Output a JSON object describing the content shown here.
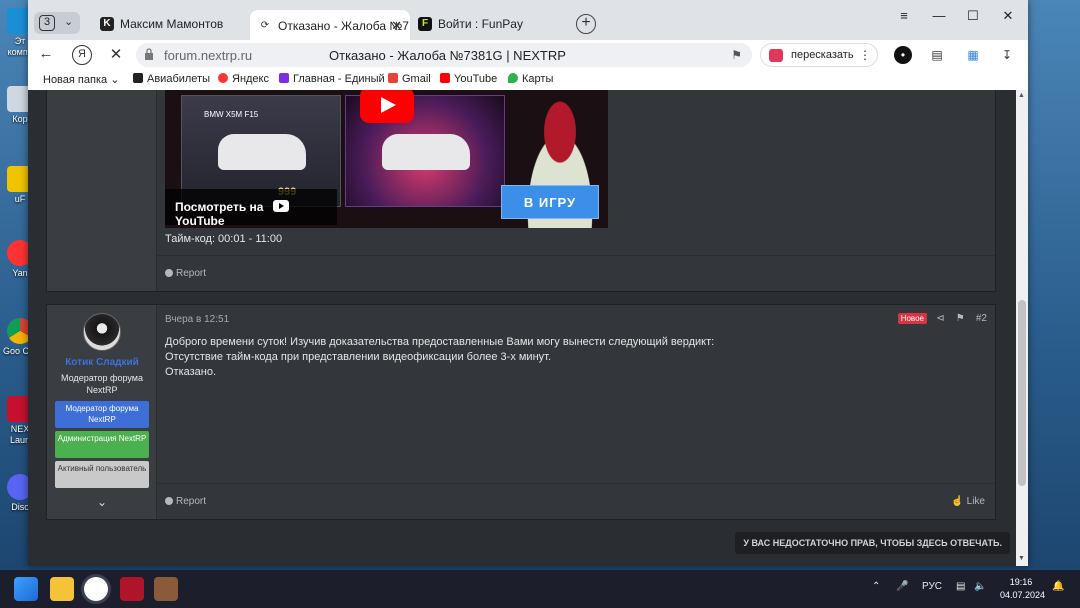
{
  "desktop": {
    "icons": [
      {
        "label": "Эт компь"
      },
      {
        "label": "Кор"
      },
      {
        "label": "uF"
      },
      {
        "label": "Yan"
      },
      {
        "label": "Goo Chr"
      },
      {
        "label": "NEX Laun"
      },
      {
        "label": "Disc"
      }
    ]
  },
  "browser": {
    "tab_count": "3",
    "tabs": [
      {
        "title": "Максим Мамонтов",
        "icon": "vk-icon"
      },
      {
        "title": "Отказано - Жалоба №7",
        "icon": "loading-icon"
      },
      {
        "title": "Войти : FunPay",
        "icon": "funpay-icon"
      }
    ],
    "url_domain": "forum.nextrp.ru",
    "page_title": "Отказано - Жалоба №7381G | NEXTRP",
    "retell_label": "пересказать",
    "bookmarks": [
      {
        "label": "Новая папка",
        "icon": "folder-icon"
      },
      {
        "label": "Авиабилеты",
        "icon": "plane-icon"
      },
      {
        "label": "Яндекс",
        "icon": "yandex-icon"
      },
      {
        "label": "Главная - Единый",
        "icon": "main-icon"
      },
      {
        "label": "Gmail",
        "icon": "gmail-icon"
      },
      {
        "label": "YouTube",
        "icon": "youtube-icon"
      },
      {
        "label": "Карты",
        "icon": "maps-icon"
      }
    ]
  },
  "forum": {
    "first_post": {
      "video": {
        "car_name": "BMW X5M F15",
        "price": "999",
        "watch_label": "Посмотреть на",
        "youtube_label": "YouTube",
        "play_label": "В ИГРУ"
      },
      "timecode": "Тайм-код: 00:01 - 11:00",
      "report_label": "Report"
    },
    "second_post": {
      "username": "Котик Сладкий",
      "user_title": "Модератор форума NextRP",
      "badges": [
        {
          "label": "Модератор форума NextRP",
          "color": "#3d6fd6"
        },
        {
          "label": "Администрация NextRP",
          "color": "#4caf50"
        },
        {
          "label": "Активный пользователь",
          "color": "#c9c9c9"
        }
      ],
      "date": "Вчера в 12:51",
      "new_badge": "Новое",
      "post_number": "#2",
      "lines": [
        "Доброго времени суток! Изучив доказательства предоставленные Вами могу вынести следующий вердикт:",
        "Отсутствие тайм-кода при представлении видеофиксации более 3-х минут.",
        "Отказано."
      ],
      "report_label": "Report",
      "like_label": "Like"
    },
    "reply_notice": "У ВАС НЕДОСТАТОЧНО ПРАВ, ЧТОБЫ ЗДЕСЬ ОТВЕЧАТЬ."
  },
  "taskbar": {
    "language": "РУС",
    "time": "19:16",
    "date": "04.07.2024"
  }
}
